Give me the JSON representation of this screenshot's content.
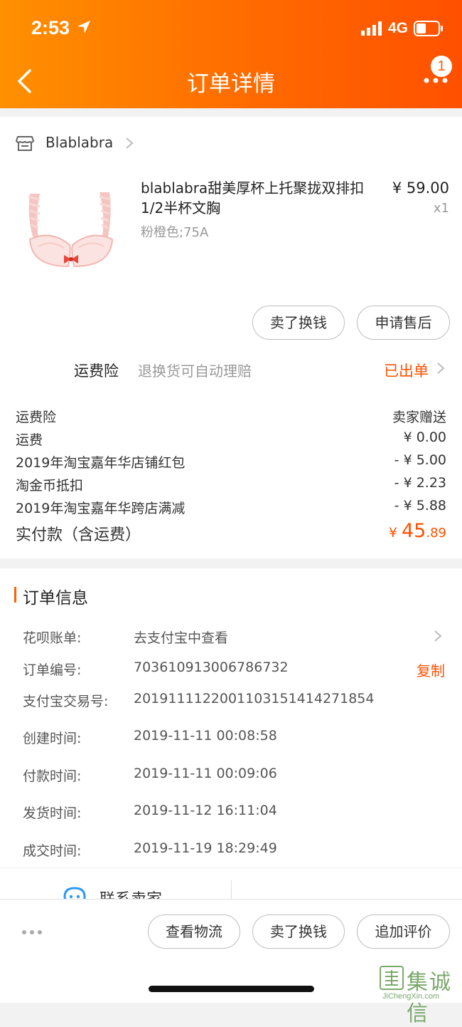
{
  "status_bar": {
    "time": "2:53",
    "network": "4G"
  },
  "header": {
    "title": "订单详情",
    "badge_count": "1"
  },
  "shop": {
    "name": "Blablabra"
  },
  "product": {
    "title": "blablabra甜美厚杯上托聚拢双排扣1/2半杯文胸",
    "spec": "粉橙色;75A",
    "price": "¥ 59.00",
    "qty": "x1"
  },
  "actions": {
    "resell": "卖了换钱",
    "after_sale": "申请售后"
  },
  "insurance": {
    "label": "运费险",
    "desc": "退换货可自动理赔",
    "status": "已出单"
  },
  "fees": [
    {
      "label": "运费险",
      "value": "卖家赠送"
    },
    {
      "label": "运费",
      "value": "¥ 0.00"
    },
    {
      "label": "2019年淘宝嘉年华店铺红包",
      "value": "- ¥ 5.00"
    },
    {
      "label": "淘金币抵扣",
      "value": "- ¥ 2.23"
    },
    {
      "label": "2019年淘宝嘉年华跨店满减",
      "value": "- ¥ 5.88"
    }
  ],
  "total": {
    "label": "实付款（含运费）",
    "currency": "¥ ",
    "integer": "45",
    "decimal": ".89"
  },
  "order_info": {
    "title": "订单信息",
    "huabei": {
      "label": "花呗账单:",
      "value": "去支付宝中查看"
    },
    "order_no": {
      "label": "订单编号:",
      "value": "703610913006786732",
      "copy": "复制"
    },
    "alipay_no": {
      "label": "支付宝交易号:",
      "value": "2019111122001103151414271854"
    },
    "created": {
      "label": "创建时间:",
      "value": "2019-11-11 00:08:58"
    },
    "paid": {
      "label": "付款时间:",
      "value": "2019-11-11 00:09:06"
    },
    "shipped": {
      "label": "发货时间:",
      "value": "2019-11-12 16:11:04"
    },
    "completed": {
      "label": "成交时间:",
      "value": "2019-11-19 18:29:49"
    }
  },
  "contact": {
    "label": "联系卖家"
  },
  "bottom_bar": {
    "logistics": "查看物流",
    "resell": "卖了换钱",
    "review": "追加评价"
  },
  "watermark": {
    "text": "集诚信",
    "url": "JiChengXin.com"
  },
  "colors": {
    "accent": "#ff5000",
    "header_start": "#ff9000",
    "header_end": "#ff5000"
  }
}
